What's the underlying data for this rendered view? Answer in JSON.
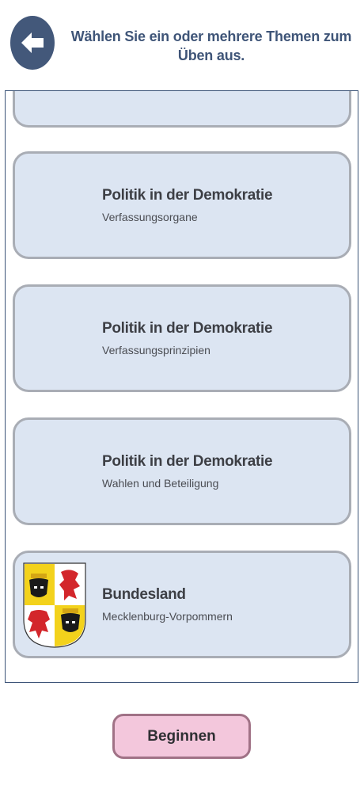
{
  "header": {
    "title": "Wählen Sie ein oder mehrere Themen zum Üben aus.",
    "back_icon": "arrow-left-icon"
  },
  "topics": [
    {
      "title": "",
      "subtitle": ""
    },
    {
      "title": "Politik in der Demokratie",
      "subtitle": "Verfassungsorgane"
    },
    {
      "title": "Politik in der Demokratie",
      "subtitle": "Verfassungsprinzipien"
    },
    {
      "title": "Politik in der Demokratie",
      "subtitle": "Wahlen und Beteiligung"
    },
    {
      "title": "Bundesland",
      "subtitle": "Mecklenburg-Vorpommern",
      "icon": "coat-of-arms-icon"
    }
  ],
  "footer": {
    "begin_label": "Beginnen"
  },
  "colors": {
    "accent": "#43587a",
    "card_bg": "#dce5f2",
    "card_border": "#a9adb5",
    "button_bg": "#f3c7dc"
  }
}
